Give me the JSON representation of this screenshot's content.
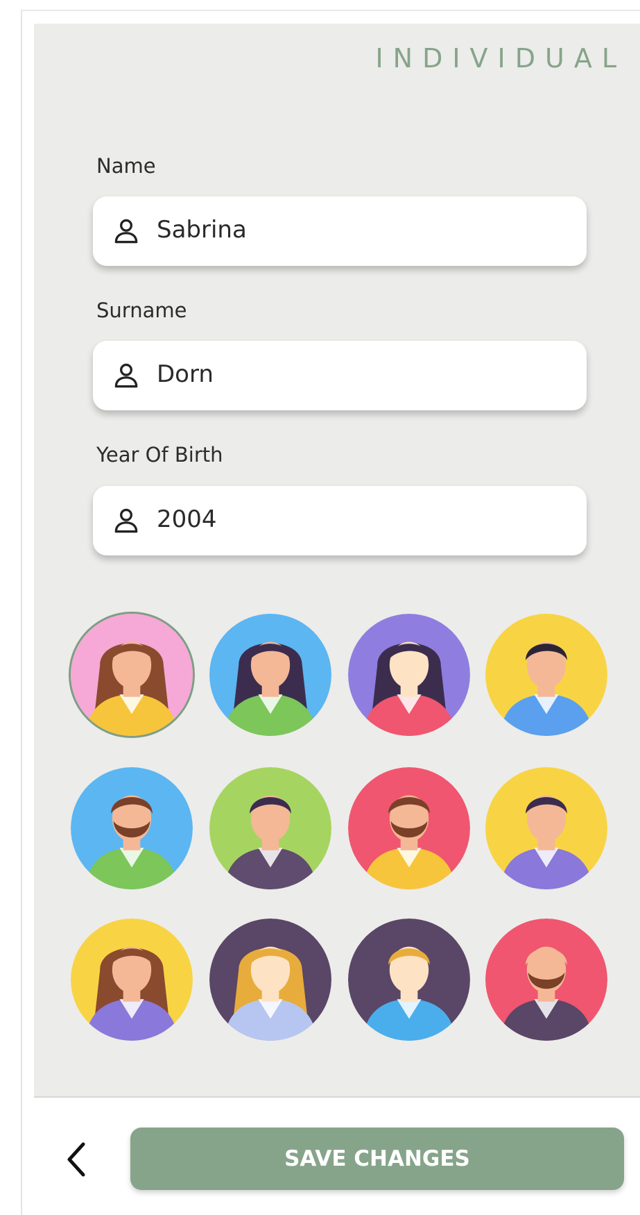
{
  "header": {
    "mode_title": "INDIVIDUAL"
  },
  "form": {
    "name": {
      "label": "Name",
      "value": "Sabrina",
      "icon": "person-icon"
    },
    "surname": {
      "label": "Surname",
      "value": "Dorn",
      "icon": "person-icon"
    },
    "year_of_birth": {
      "label": "Year Of Birth",
      "value": "2004",
      "icon": "person-icon"
    }
  },
  "avatars": {
    "selected_index": 0,
    "items": [
      {
        "bg": "#f6a8d6",
        "hair": "#8a4a2e",
        "skin": "#f4b896",
        "shirt": "#f7c53b",
        "beard": false,
        "long_hair": true
      },
      {
        "bg": "#5bb6f2",
        "hair": "#3c2d4e",
        "skin": "#f4b896",
        "shirt": "#7cc65a",
        "beard": false,
        "long_hair": true
      },
      {
        "bg": "#8f7ee0",
        "hair": "#3c2d4e",
        "skin": "#fde3c4",
        "shirt": "#f0566f",
        "beard": false,
        "long_hair": true
      },
      {
        "bg": "#f8d444",
        "hair": "#2b2436",
        "skin": "#f4b896",
        "shirt": "#5aa0ee",
        "beard": false,
        "long_hair": false
      },
      {
        "bg": "#5bb6f2",
        "hair": "#7a4028",
        "skin": "#f4b896",
        "shirt": "#7cc65a",
        "beard": true,
        "long_hair": false
      },
      {
        "bg": "#a6d460",
        "hair": "#3c2d4e",
        "skin": "#f4b896",
        "shirt": "#5f4c6e",
        "beard": false,
        "long_hair": false
      },
      {
        "bg": "#f0566f",
        "hair": "#7a4028",
        "skin": "#f4b896",
        "shirt": "#f7c53b",
        "beard": true,
        "long_hair": false
      },
      {
        "bg": "#f8d444",
        "hair": "#3c2d4e",
        "skin": "#f4b896",
        "shirt": "#8a78da",
        "beard": false,
        "long_hair": false
      },
      {
        "bg": "#f8d444",
        "hair": "#8a4a2e",
        "skin": "#f4b896",
        "shirt": "#8a78da",
        "beard": false,
        "long_hair": true
      },
      {
        "bg": "#5a4666",
        "hair": "#e8ac3c",
        "skin": "#fde3c4",
        "shirt": "#b7c6f0",
        "beard": false,
        "long_hair": true
      },
      {
        "bg": "#5a4666",
        "hair": "#e8ac3c",
        "skin": "#fde3c4",
        "shirt": "#4aaeec",
        "beard": false,
        "long_hair": false
      },
      {
        "bg": "#f0566f",
        "hair": "#f4b896",
        "skin": "#f4b896",
        "shirt": "#5a4666",
        "beard": true,
        "long_hair": false
      }
    ]
  },
  "footer": {
    "back_icon": "chevron-left-icon",
    "save_label": "SAVE CHANGES"
  },
  "colors": {
    "accent": "#86a48a",
    "panel_bg": "#ececea"
  }
}
